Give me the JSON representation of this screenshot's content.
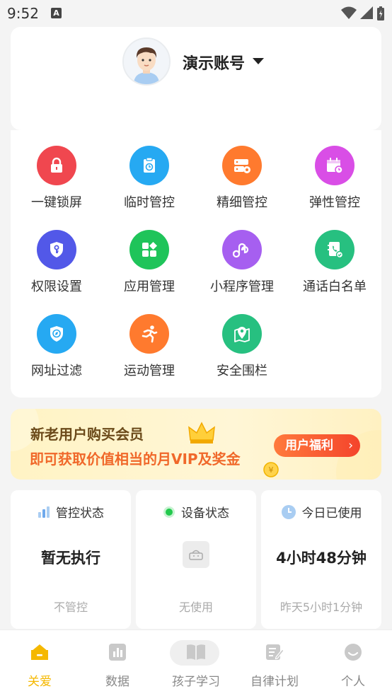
{
  "status_bar": {
    "time": "9:52",
    "notification_glyph": "A"
  },
  "profile": {
    "account_name": "演示账号"
  },
  "features": [
    {
      "label": "一键锁屏",
      "icon": "lock-icon",
      "color": "#f0474f"
    },
    {
      "label": "临时管控",
      "icon": "clipboard-clock-icon",
      "color": "#26a9f2"
    },
    {
      "label": "精细管控",
      "icon": "server-settings-icon",
      "color": "#ff7a2e"
    },
    {
      "label": "弹性管控",
      "icon": "calendar-clock-icon",
      "color": "#d94ee6"
    },
    {
      "label": "权限设置",
      "icon": "shield-key-icon",
      "color": "#5258e8"
    },
    {
      "label": "应用管理",
      "icon": "app-grid-icon",
      "color": "#1fc45a"
    },
    {
      "label": "小程序管理",
      "icon": "mini-program-icon",
      "color": "#a65ff0"
    },
    {
      "label": "通话白名单",
      "icon": "contact-book-icon",
      "color": "#27c080"
    },
    {
      "label": "网址过滤",
      "icon": "shield-compass-icon",
      "color": "#26a9f2"
    },
    {
      "label": "运动管理",
      "icon": "running-person-icon",
      "color": "#ff7a2e"
    },
    {
      "label": "安全围栏",
      "icon": "map-pin-icon",
      "color": "#27c080"
    }
  ],
  "banner": {
    "line1": "新老用户购买会员",
    "line2": "即可获取价值相当的月VIP及奖金",
    "button_label": "用户福利",
    "button_chevron": "›"
  },
  "stats": {
    "control": {
      "title": "管控状态",
      "value": "暂无执行",
      "sub": "不管控"
    },
    "device": {
      "title": "设备状态",
      "sub": "无使用"
    },
    "usage": {
      "title": "今日已使用",
      "value": "4小时48分钟",
      "sub": "昨天5小时1分钟"
    }
  },
  "tabs": [
    {
      "label": "关爱",
      "icon": "home-icon",
      "active": true
    },
    {
      "label": "数据",
      "icon": "bar-chart-icon",
      "active": false
    },
    {
      "label": "孩子学习",
      "icon": "book-icon",
      "active": false
    },
    {
      "label": "自律计划",
      "icon": "plan-edit-icon",
      "active": false
    },
    {
      "label": "个人",
      "icon": "smile-icon",
      "active": false
    }
  ],
  "colors": {
    "accent": "#f5b800",
    "banner_orange": "#f0682a",
    "banner_brown": "#6b4a1a"
  }
}
